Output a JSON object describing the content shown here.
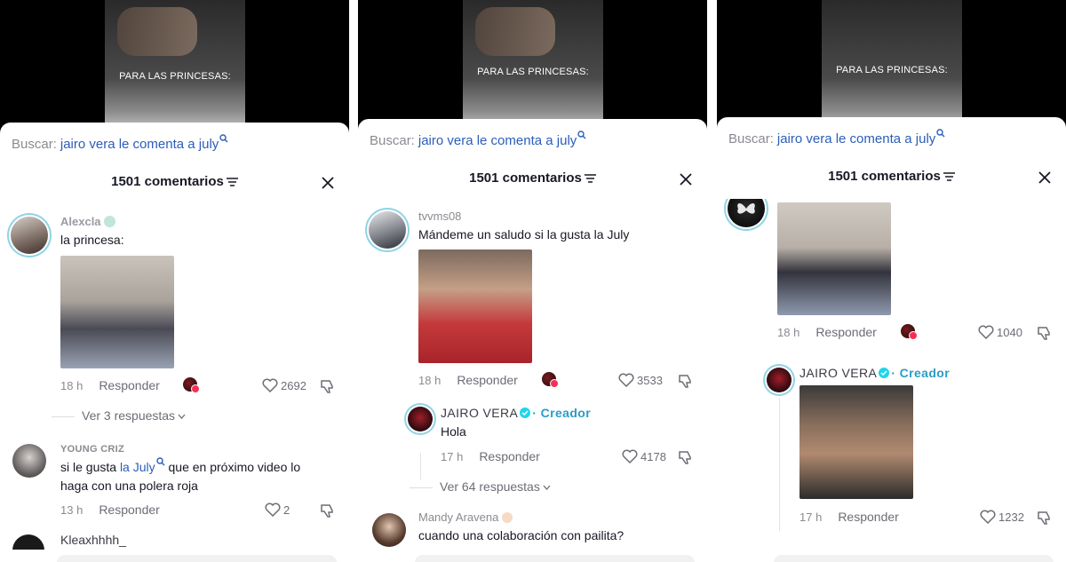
{
  "video": {
    "caption": "PARA LAS PRINCESAS:"
  },
  "search": {
    "label": "Buscar:",
    "term": "jairo vera le comenta a july"
  },
  "header": {
    "count": "1501 comentarios"
  },
  "panel1": {
    "c1": {
      "user": "Alexcla",
      "text": "la princesa:",
      "time": "18 h",
      "reply": "Responder",
      "likes": "2692",
      "more": "Ver 3 respuestas"
    },
    "c2": {
      "user": "YOUNG CRIZ",
      "text_a": "si le gusta ",
      "text_link": "la July",
      "text_b": " que en próximo video lo haga con una polera roja",
      "time": "13 h",
      "reply": "Responder",
      "likes": "2"
    },
    "c3": {
      "user": "Kleaxhhhh_"
    }
  },
  "panel2": {
    "c1": {
      "user": "tvvms08",
      "text": "Mándeme un saludo si la gusta la July",
      "time": "18 h",
      "reply": "Responder",
      "likes": "3533"
    },
    "r1": {
      "user": "JAIRO VERA",
      "badge": "· Creador",
      "text": "Hola",
      "time": "17 h",
      "reply": "Responder",
      "likes": "4178"
    },
    "more": "Ver 64 respuestas",
    "c2": {
      "user": "Mandy Aravena",
      "text": "cuando una colaboración con pailita?"
    }
  },
  "panel3": {
    "c1": {
      "time": "18 h",
      "reply": "Responder",
      "likes": "1040"
    },
    "r1": {
      "user": "JAIRO VERA",
      "badge": "· Creador",
      "time": "17 h",
      "reply": "Responder",
      "likes": "1232"
    }
  },
  "colors": {
    "accent_link": "#2b5db9",
    "creator_badge": "#2b9cc9",
    "ring": "#8fd4e6",
    "like_red": "#fe2c55"
  }
}
